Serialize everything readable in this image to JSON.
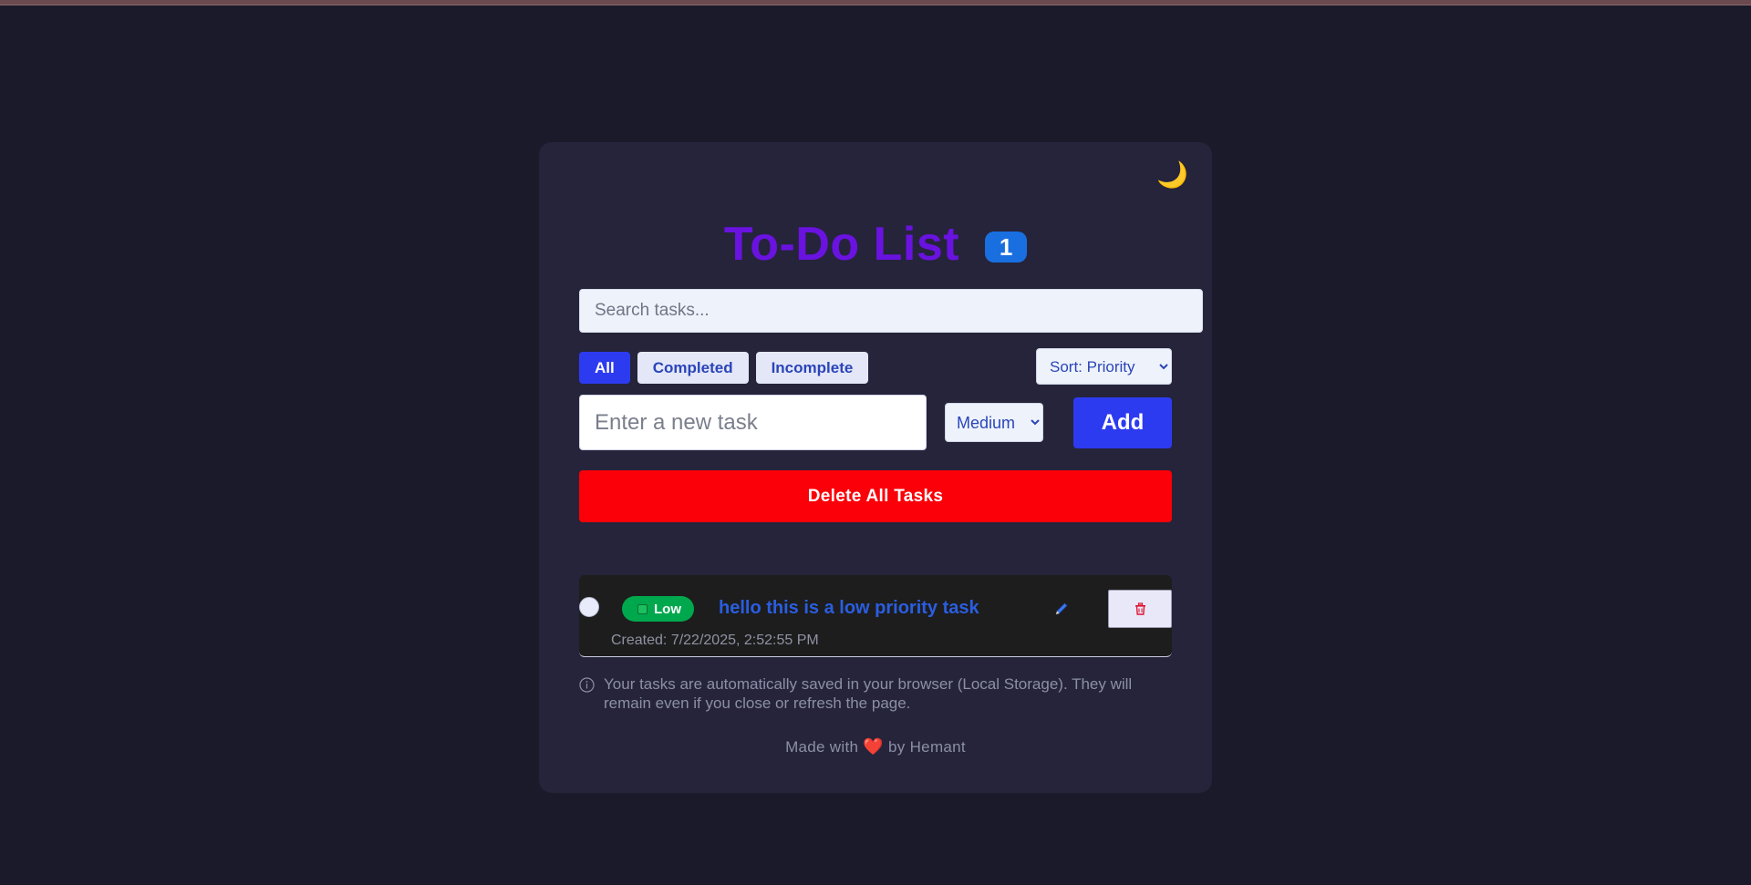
{
  "app": {
    "title": "To-Do List",
    "task_count": "1",
    "theme_icon": "moon-icon"
  },
  "search": {
    "placeholder": "Search tasks..."
  },
  "filters": {
    "all": "All",
    "completed": "Completed",
    "incomplete": "Incomplete",
    "active": "All"
  },
  "sort": {
    "selected": "Sort: Priority"
  },
  "new_task": {
    "placeholder": "Enter a new task",
    "priority_selected": "Medium",
    "add_label": "Add"
  },
  "delete_all_label": "Delete All Tasks",
  "tasks": [
    {
      "priority": "Low",
      "priority_color": "#00a84d",
      "text": "hello this is a low priority task",
      "created": "Created: 7/22/2025, 2:52:55 PM",
      "completed": false
    }
  ],
  "info_note": "Your tasks are automatically saved in your browser (Local Storage). They will remain even if you close or refresh the page.",
  "footer": {
    "before": "Made with",
    "heart": "❤️",
    "after": "by Hemant"
  },
  "colors": {
    "background": "#1a1a2a",
    "card": "#25243b",
    "title": "#6a12e0",
    "accent": "#2d3bf0",
    "danger": "#fb0008",
    "badge": "#1a6fe0"
  }
}
